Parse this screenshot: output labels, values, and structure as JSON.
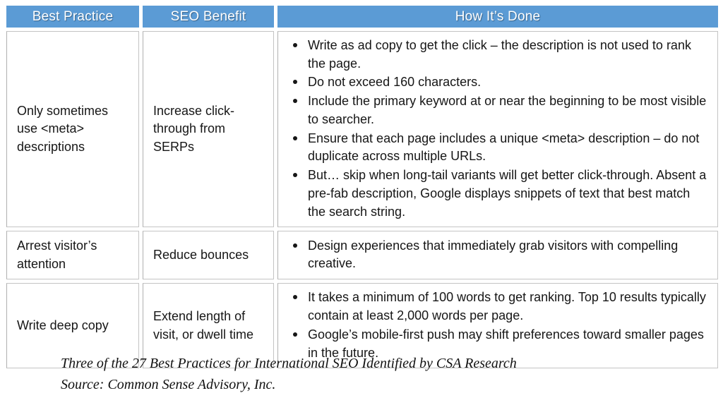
{
  "table": {
    "headers": [
      {
        "label": "Best Practice",
        "name": "header-best-practice"
      },
      {
        "label": "SEO Benefit",
        "name": "header-seo-benefit"
      },
      {
        "label": "How It’s Done",
        "name": "header-how-its-done"
      }
    ],
    "header_bg_color": "#5B9BD5",
    "header_text_color": "#FFFFFF",
    "border_color": "#C4C4C4",
    "rows": [
      {
        "practice": "Only sometimes use <meta> descriptions",
        "benefit": "Increase click-through from SERPs",
        "how": [
          "Write as ad copy to get the click – the description is not used to rank the page.",
          "Do not exceed 160 characters.",
          "Include the primary keyword at or near the beginning to be most visible to searcher.",
          "Ensure that each page includes a unique <meta> description – do not duplicate across multiple URLs.",
          "But… skip when long-tail variants will get better click-through. Absent a pre-fab description, Google displays snippets of text that best match the search string."
        ]
      },
      {
        "practice": "Arrest visitor’s attention",
        "benefit": "Reduce bounces",
        "how": [
          "Design experiences that immediately grab visitors with compelling creative."
        ]
      },
      {
        "practice": "Write deep copy",
        "benefit": "Extend length of visit, or dwell time",
        "how": [
          "It takes a minimum of 100 words to get ranking. Top 10 results typically contain at least 2,000 words per page.",
          "Google’s mobile-first push may shift preferences toward smaller pages in the future."
        ]
      }
    ]
  },
  "caption": {
    "line1": "Three of the 27 Best Practices for International SEO Identified by CSA Research",
    "line2": "Source: Common Sense Advisory, Inc."
  }
}
